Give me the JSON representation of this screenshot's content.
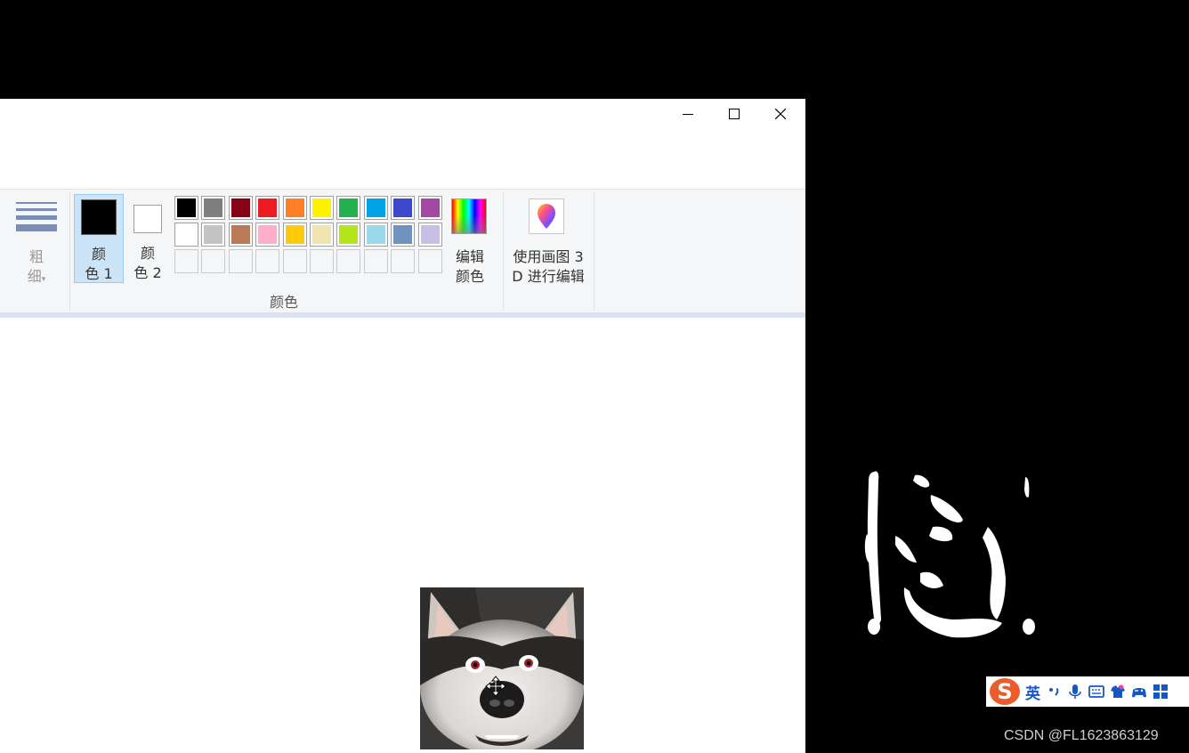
{
  "window": {
    "controls": {
      "minimize_icon": "minimize-icon",
      "maximize_icon": "maximize-icon",
      "close_icon": "close-icon"
    }
  },
  "ribbon": {
    "thickness_label_1": "粗",
    "thickness_label_2": "细",
    "color1_label_1": "颜",
    "color1_label_2": "色 1",
    "color1_value": "#000000",
    "color2_label_1": "颜",
    "color2_label_2": "色 2",
    "color2_value": "#ffffff",
    "palette_row1": [
      "#000000",
      "#7f7f7f",
      "#880015",
      "#ed1c24",
      "#ff7f27",
      "#fff200",
      "#22b14c",
      "#00a2e8",
      "#3f48cc",
      "#a349a4"
    ],
    "palette_row2": [
      "#ffffff",
      "#c3c3c3",
      "#b97a57",
      "#ffaec9",
      "#ffc90e",
      "#efe4b0",
      "#b5e61d",
      "#99d9ea",
      "#7092be",
      "#c8bfe7"
    ],
    "edit_colors_label_1": "编辑",
    "edit_colors_label_2": "颜色",
    "paint3d_label_1": "使用画图 3",
    "paint3d_label_2": "D 进行编辑",
    "colors_group_label": "颜色"
  },
  "taskbar_ime": {
    "logo": "S",
    "language": "英",
    "icons": [
      "punctuation-icon",
      "microphone-icon",
      "keyboard-icon",
      "skin-icon",
      "gamepad-icon",
      "toolbox-icon"
    ]
  },
  "watermark": "CSDN @FL1623863129"
}
